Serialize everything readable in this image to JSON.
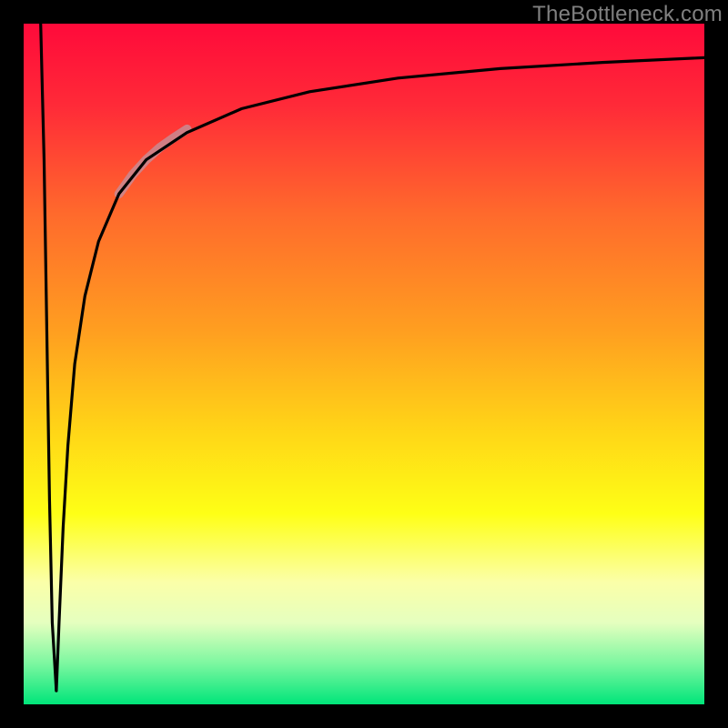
{
  "watermark": {
    "text": "TheBottleneck.com"
  },
  "background": {
    "frame_color": "#000000",
    "gradient_stops": [
      {
        "pct": 0,
        "color": "#ff0a3a"
      },
      {
        "pct": 12,
        "color": "#ff2a38"
      },
      {
        "pct": 28,
        "color": "#ff6a2c"
      },
      {
        "pct": 45,
        "color": "#ff9e20"
      },
      {
        "pct": 60,
        "color": "#ffd617"
      },
      {
        "pct": 72,
        "color": "#feff16"
      },
      {
        "pct": 82,
        "color": "#fbffa8"
      },
      {
        "pct": 88,
        "color": "#e5ffbf"
      },
      {
        "pct": 94,
        "color": "#7cf7a0"
      },
      {
        "pct": 100,
        "color": "#00e57a"
      }
    ]
  },
  "curve_style": {
    "main_stroke": "#000000",
    "main_width": 3.2,
    "highlight_stroke": "#c98a93",
    "highlight_width": 10,
    "highlight_opacity": 0.85
  },
  "chart_data": {
    "type": "line",
    "title": "",
    "xlabel": "",
    "ylabel": "",
    "xlim": [
      0,
      100
    ],
    "ylim": [
      0,
      100
    ],
    "grid": false,
    "legend": false,
    "series": [
      {
        "name": "left-descending-edge",
        "x": [
          2.5,
          3.0,
          3.4,
          3.8,
          4.2,
          4.8
        ],
        "y": [
          100,
          80,
          55,
          30,
          12,
          2
        ]
      },
      {
        "name": "main-curve",
        "x": [
          4.8,
          5.2,
          5.8,
          6.5,
          7.5,
          9,
          11,
          14,
          18,
          24,
          32,
          42,
          55,
          70,
          85,
          100
        ],
        "y": [
          2,
          12,
          26,
          38,
          50,
          60,
          68,
          75,
          80,
          84,
          87.5,
          90,
          92,
          93.4,
          94.3,
          95
        ]
      },
      {
        "name": "highlighted-segment",
        "x": [
          14,
          16,
          18,
          20,
          22,
          24
        ],
        "y": [
          75,
          77.8,
          80,
          81.8,
          83.2,
          84.5
        ]
      }
    ]
  }
}
